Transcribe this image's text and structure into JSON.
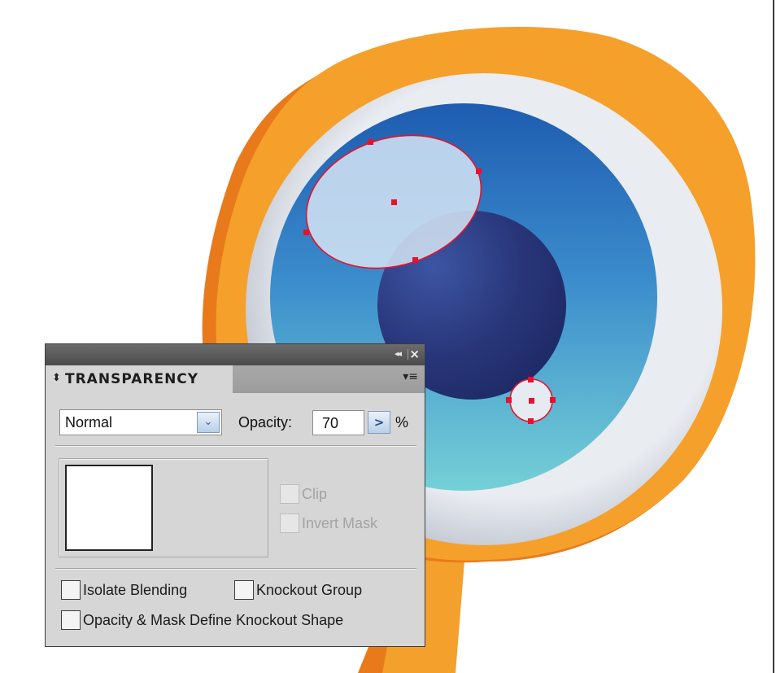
{
  "colors": {
    "orange_outer": "#f5a02a",
    "orange_shadow": "#e87a1c",
    "sclera": "#d2d7e0",
    "iris_top": "#1f5fb3",
    "iris_bottom": "#6fcad6",
    "pupil": "#283578",
    "highlight": "#c3d9ee",
    "selection": "#e8112d"
  },
  "panel": {
    "title": "TRANSPARENCY",
    "tab_arrows_icon": "up-down-arrows-icon",
    "collapse_glyph": "◂◂",
    "close_glyph": "×",
    "menu_glyph": "▾≡",
    "blend_mode": "Normal",
    "blend_arrow_glyph": "⌄",
    "opacity_label": "Opacity:",
    "opacity_value": "70",
    "opacity_stepper_glyph": ">",
    "opacity_unit": "%",
    "checkboxes": {
      "clip": "Clip",
      "invert_mask": "Invert Mask",
      "isolate_blending": "Isolate Blending",
      "knockout_group": "Knockout Group",
      "opacity_mask_define_knockout": "Opacity & Mask Define Knockout Shape"
    }
  }
}
